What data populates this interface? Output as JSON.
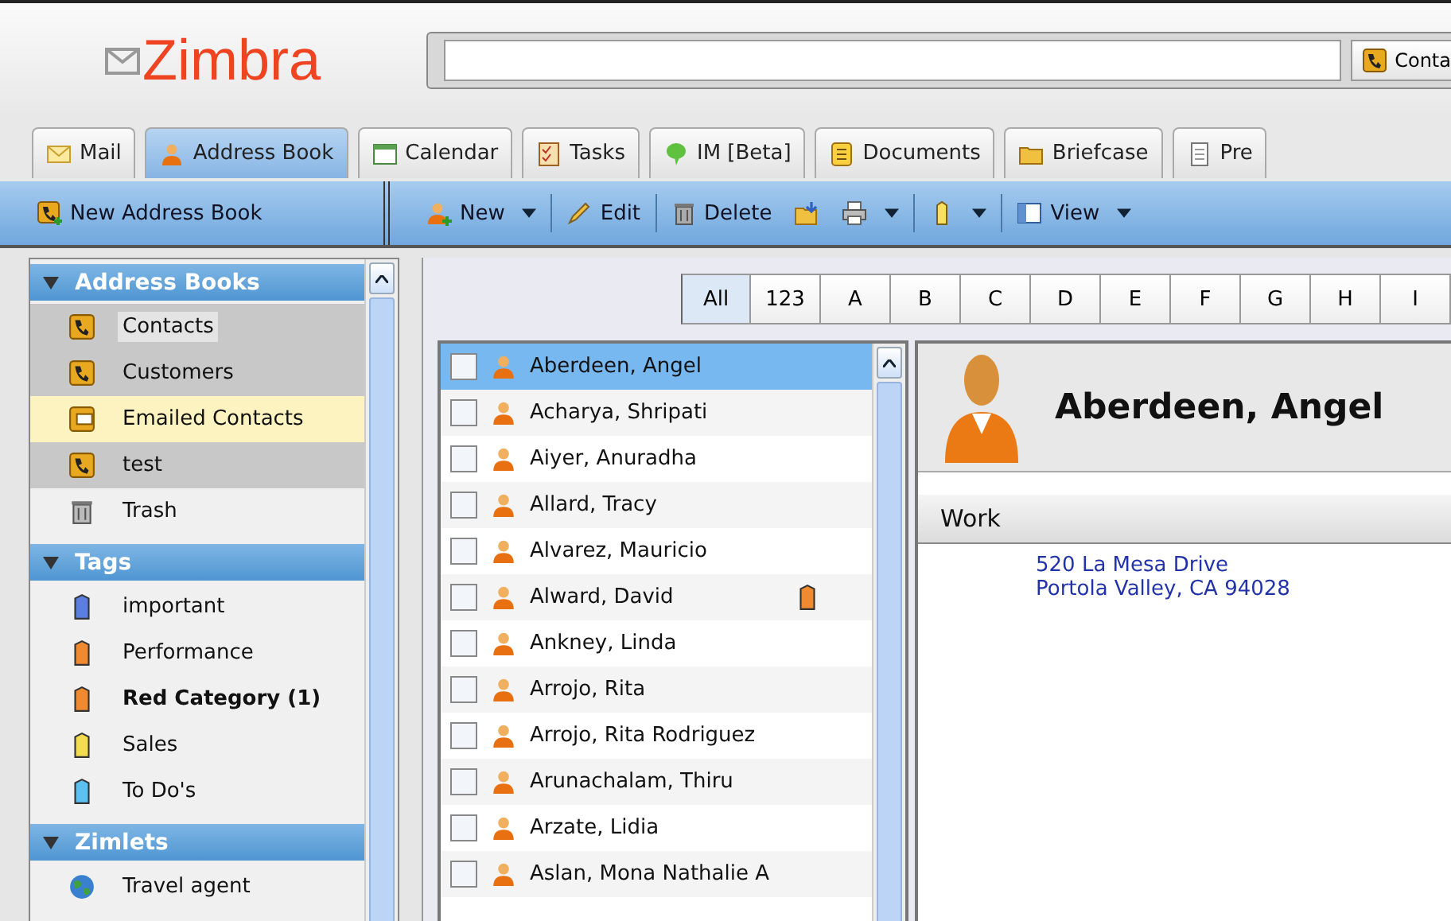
{
  "logo": "Zimbra",
  "search": {
    "button": "Conta"
  },
  "tabs": [
    {
      "label": "Mail",
      "kind": "mail",
      "selected": false
    },
    {
      "label": "Address Book",
      "kind": "person",
      "selected": true
    },
    {
      "label": "Calendar",
      "kind": "calendar",
      "selected": false
    },
    {
      "label": "Tasks",
      "kind": "tasks",
      "selected": false
    },
    {
      "label": "IM [Beta]",
      "kind": "chat",
      "selected": false
    },
    {
      "label": "Documents",
      "kind": "note",
      "selected": false
    },
    {
      "label": "Briefcase",
      "kind": "folder",
      "selected": false
    },
    {
      "label": "Pre",
      "kind": "page",
      "selected": false
    }
  ],
  "left_toolbar": {
    "label": "New Address Book"
  },
  "toolbar": [
    {
      "kind": "new",
      "label": "New",
      "menu": true
    },
    {
      "kind": "edit",
      "label": "Edit",
      "menu": false
    },
    {
      "kind": "delete",
      "label": "Delete",
      "menu": false
    },
    {
      "kind": "move",
      "menu": false
    },
    {
      "kind": "print",
      "menu": true
    },
    {
      "kind": "tag",
      "menu": true
    },
    {
      "kind": "view",
      "label": "View",
      "menu": true
    }
  ],
  "sidebar": [
    {
      "title": "Address Books",
      "expanded": true,
      "items": [
        {
          "label": "Contacts",
          "kind": "book",
          "selected": true,
          "highlighted": false
        },
        {
          "label": "Customers",
          "kind": "book",
          "selected": false,
          "highlighted": false
        },
        {
          "label": "Emailed Contacts",
          "kind": "emailed",
          "selected": false,
          "highlighted": true
        },
        {
          "label": "test",
          "kind": "book",
          "selected": false,
          "highlighted": false
        },
        {
          "label": "Trash",
          "kind": "trash",
          "selected": false,
          "highlighted": false
        }
      ]
    },
    {
      "title": "Tags",
      "expanded": true,
      "items": [
        {
          "label": "important",
          "kind": "tag",
          "color": "#5b7fe0",
          "bold": false
        },
        {
          "label": "Performance",
          "kind": "tag",
          "color": "#f08a30",
          "bold": false
        },
        {
          "label": "Red Category (1)",
          "kind": "tag",
          "color": "#f08a30",
          "bold": true
        },
        {
          "label": "Sales",
          "kind": "tag",
          "color": "#f2dc50",
          "bold": false
        },
        {
          "label": "To Do's",
          "kind": "tag",
          "color": "#5cc0f0",
          "bold": false
        }
      ]
    },
    {
      "title": "Zimlets",
      "expanded": true,
      "items": [
        {
          "label": "Travel agent",
          "kind": "globe"
        }
      ]
    }
  ],
  "letters": [
    {
      "label": "All",
      "selected": true
    },
    {
      "label": "123",
      "selected": false
    },
    {
      "label": "A",
      "selected": false
    },
    {
      "label": "B",
      "selected": false
    },
    {
      "label": "C",
      "selected": false
    },
    {
      "label": "D",
      "selected": false
    },
    {
      "label": "E",
      "selected": false
    },
    {
      "label": "F",
      "selected": false
    },
    {
      "label": "G",
      "selected": false
    },
    {
      "label": "H",
      "selected": false
    },
    {
      "label": "I",
      "selected": false
    }
  ],
  "contacts": [
    {
      "name": "Aberdeen, Angel",
      "checked": false,
      "selected": true
    },
    {
      "name": "Acharya, Shripati",
      "checked": false,
      "selected": false
    },
    {
      "name": "Aiyer, Anuradha",
      "checked": false,
      "selected": false
    },
    {
      "name": "Allard, Tracy",
      "checked": false,
      "selected": false
    },
    {
      "name": "Alvarez, Mauricio",
      "checked": false,
      "selected": false
    },
    {
      "name": "Alward, David",
      "checked": false,
      "selected": false,
      "color": "#f08a30"
    },
    {
      "name": "Ankney, Linda",
      "checked": false,
      "selected": false
    },
    {
      "name": "Arrojo, Rita",
      "checked": false,
      "selected": false
    },
    {
      "name": "Arrojo, Rita Rodriguez",
      "checked": false,
      "selected": false
    },
    {
      "name": "Arunachalam, Thiru",
      "checked": false,
      "selected": false
    },
    {
      "name": "Arzate, Lidia",
      "checked": false,
      "selected": false
    },
    {
      "name": "Aslan, Mona Nathalie A",
      "checked": false,
      "selected": false
    }
  ],
  "detail": {
    "name": "Aberdeen, Angel",
    "section": "Work",
    "address": [
      "520 La Mesa Drive",
      "Portola Valley, CA 94028"
    ]
  }
}
